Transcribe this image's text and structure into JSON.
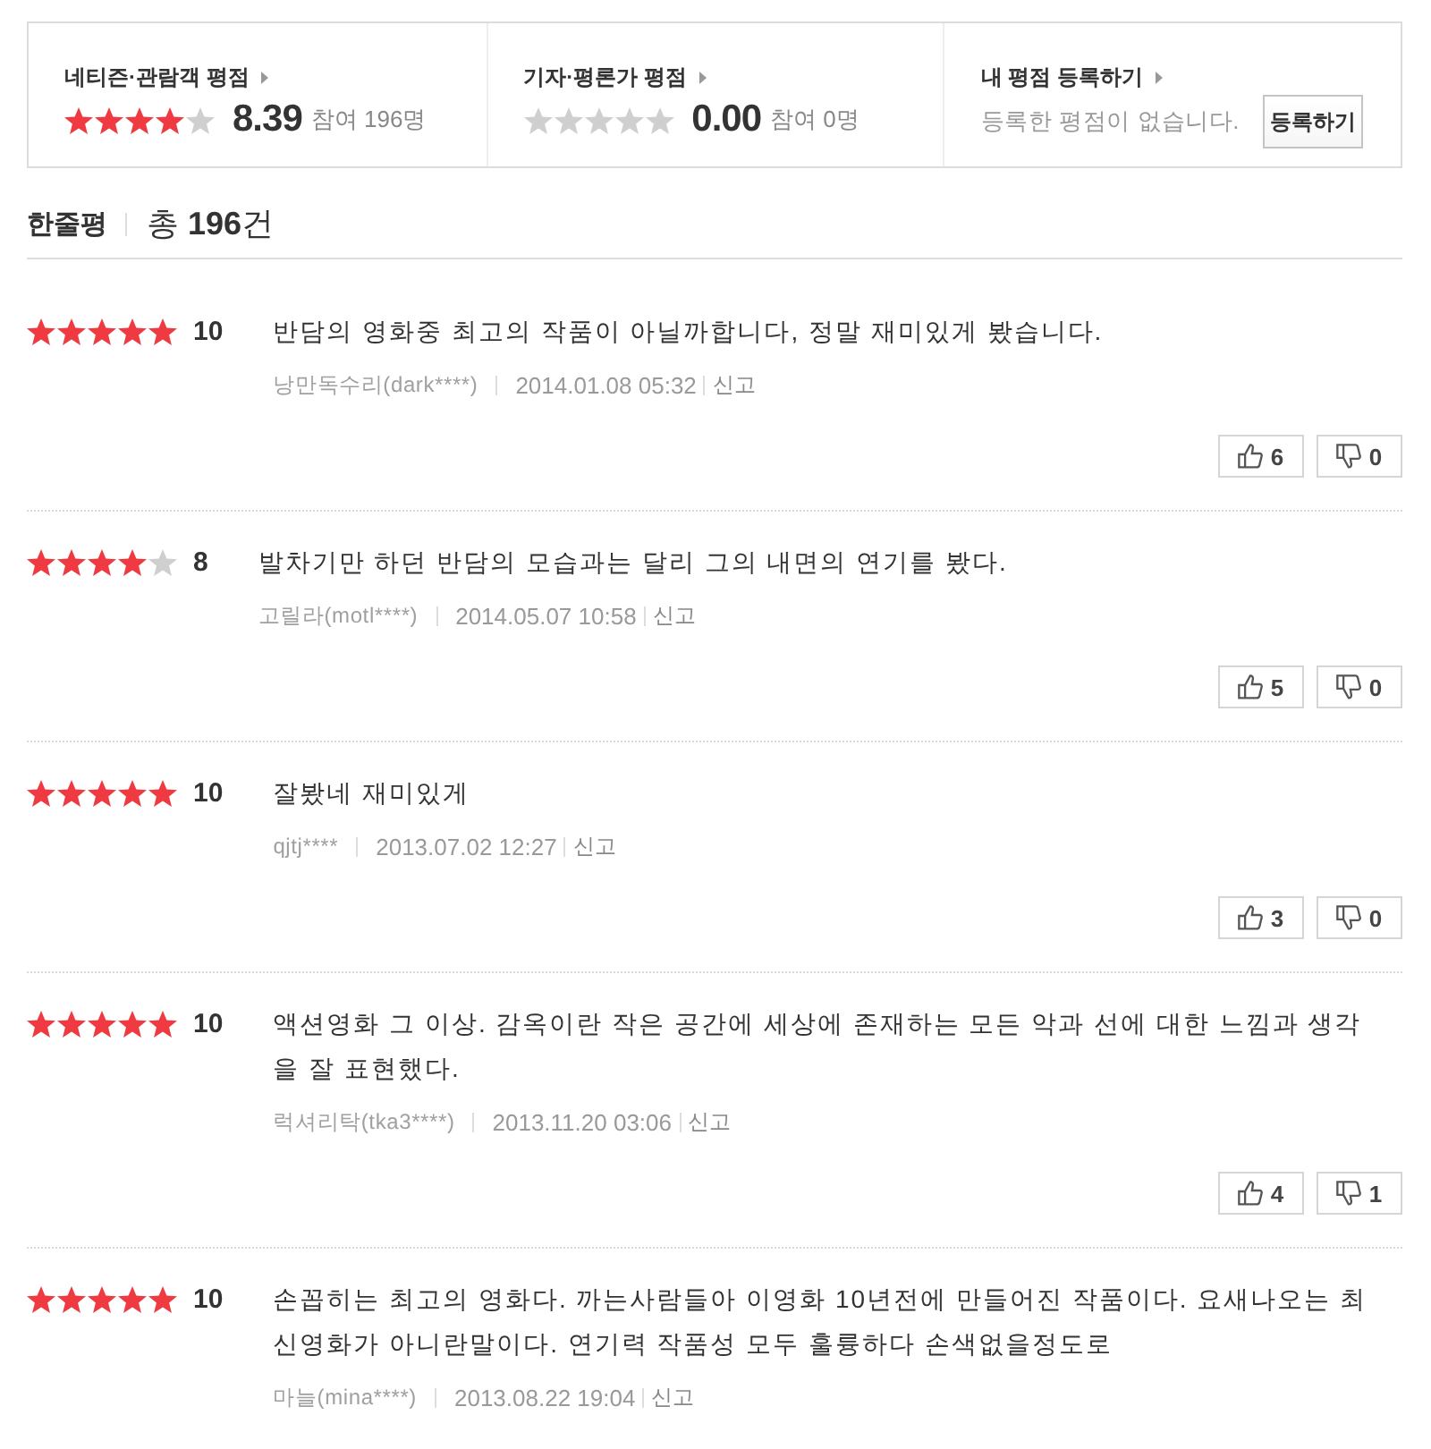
{
  "rating_summary": [
    {
      "kind": "score",
      "title": "네티즌·관람객 평점",
      "stars": 4,
      "score": "8.39",
      "participants": "참여 196명"
    },
    {
      "kind": "score",
      "title": "기자·평론가 평점",
      "stars": 0,
      "score": "0.00",
      "participants": "참여 0명"
    },
    {
      "kind": "register",
      "title": "내 평점 등록하기",
      "message": "등록한 평점이 없습니다.",
      "button": "등록하기"
    }
  ],
  "section": {
    "title": "한줄평",
    "total": "총 **196**건"
  },
  "reviews": [
    {
      "stars": 5,
      "score": "10",
      "text": "반담의 영화중 최고의 작품이 아닐까합니다, 정말 재미있게 봤습니다.",
      "author": "낭만독수리(dark****)",
      "date": "2014.01.08 05:32",
      "report": "신고",
      "likes": "6",
      "dislikes": "0"
    },
    {
      "stars": 4,
      "score": "8",
      "text": "발차기만 하던 반담의 모습과는 달리 그의 내면의 연기를 봤다.",
      "author": "고릴라(motl****)",
      "date": "2014.05.07 10:58",
      "report": "신고",
      "likes": "5",
      "dislikes": "0"
    },
    {
      "stars": 5,
      "score": "10",
      "text": "잘봤네 재미있게",
      "author": "qjtj****",
      "date": "2013.07.02 12:27",
      "report": "신고",
      "likes": "3",
      "dislikes": "0"
    },
    {
      "stars": 5,
      "score": "10",
      "text": "액션영화 그 이상. 감옥이란 작은 공간에 세상에 존재하는 모든 악과 선에 대한 느낌과 생각을 잘 표현했다.",
      "author": "럭셔리탁(tka3****)",
      "date": "2013.11.20 03:06",
      "report": "신고",
      "likes": "4",
      "dislikes": "1"
    },
    {
      "stars": 5,
      "score": "10",
      "text": "손꼽히는 최고의 영화다. 까는사람들아 이영화 10년전에 만들어진 작품이다. 요새나오는 최신영화가 아니란말이다. 연기력 작품성 모두 훌륭하다 손색없을정도로",
      "author": "마늘(mina****)",
      "date": "2013.08.22 19:04",
      "report": "신고"
    }
  ]
}
